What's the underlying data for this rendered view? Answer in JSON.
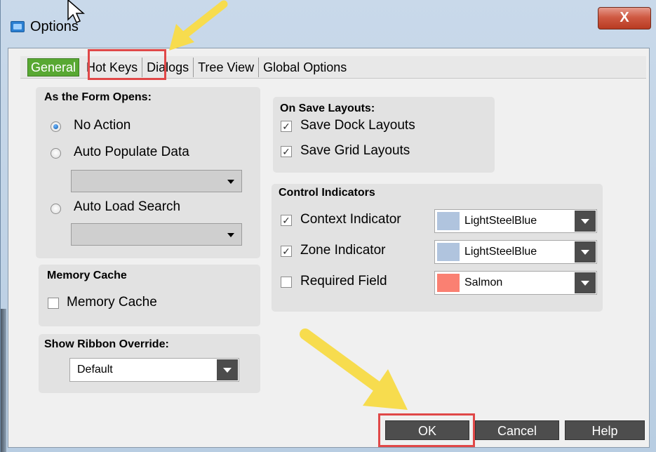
{
  "window": {
    "title": "Options",
    "close_symbol": "X"
  },
  "tabs": [
    {
      "label": "General",
      "active": true
    },
    {
      "label": "Hot Keys",
      "active": false
    },
    {
      "label": "Dialogs",
      "active": false
    },
    {
      "label": "Tree View",
      "active": false
    },
    {
      "label": "Global Options",
      "active": false
    }
  ],
  "form_opens": {
    "title": "As the Form Opens:",
    "options": [
      {
        "label": "No Action",
        "selected": true
      },
      {
        "label": "Auto Populate Data",
        "selected": false
      },
      {
        "label": "Auto Load Search",
        "selected": false
      }
    ]
  },
  "memory_cache": {
    "title": "Memory Cache",
    "checkbox_label": "Memory Cache",
    "checked": false
  },
  "ribbon": {
    "title": "Show Ribbon Override:",
    "value": "Default"
  },
  "save_layouts": {
    "title": "On Save Layouts:",
    "items": [
      {
        "label": "Save Dock Layouts",
        "checked": true
      },
      {
        "label": "Save Grid Layouts",
        "checked": true
      }
    ]
  },
  "control_indicators": {
    "title": "Control Indicators",
    "items": [
      {
        "label": "Context Indicator",
        "checked": true,
        "color_name": "LightSteelBlue",
        "color": "#b0c4de"
      },
      {
        "label": "Zone Indicator",
        "checked": true,
        "color_name": "LightSteelBlue",
        "color": "#b0c4de"
      },
      {
        "label": "Required Field",
        "checked": false,
        "color_name": "Salmon",
        "color": "#fa8072"
      }
    ]
  },
  "footer": {
    "ok": "OK",
    "cancel": "Cancel",
    "help": "Help"
  },
  "check_mark": "✓",
  "colors": {
    "active_tab": "#58a832",
    "highlight_box": "#e04848",
    "annotation_arrow": "#f7dc4e"
  }
}
